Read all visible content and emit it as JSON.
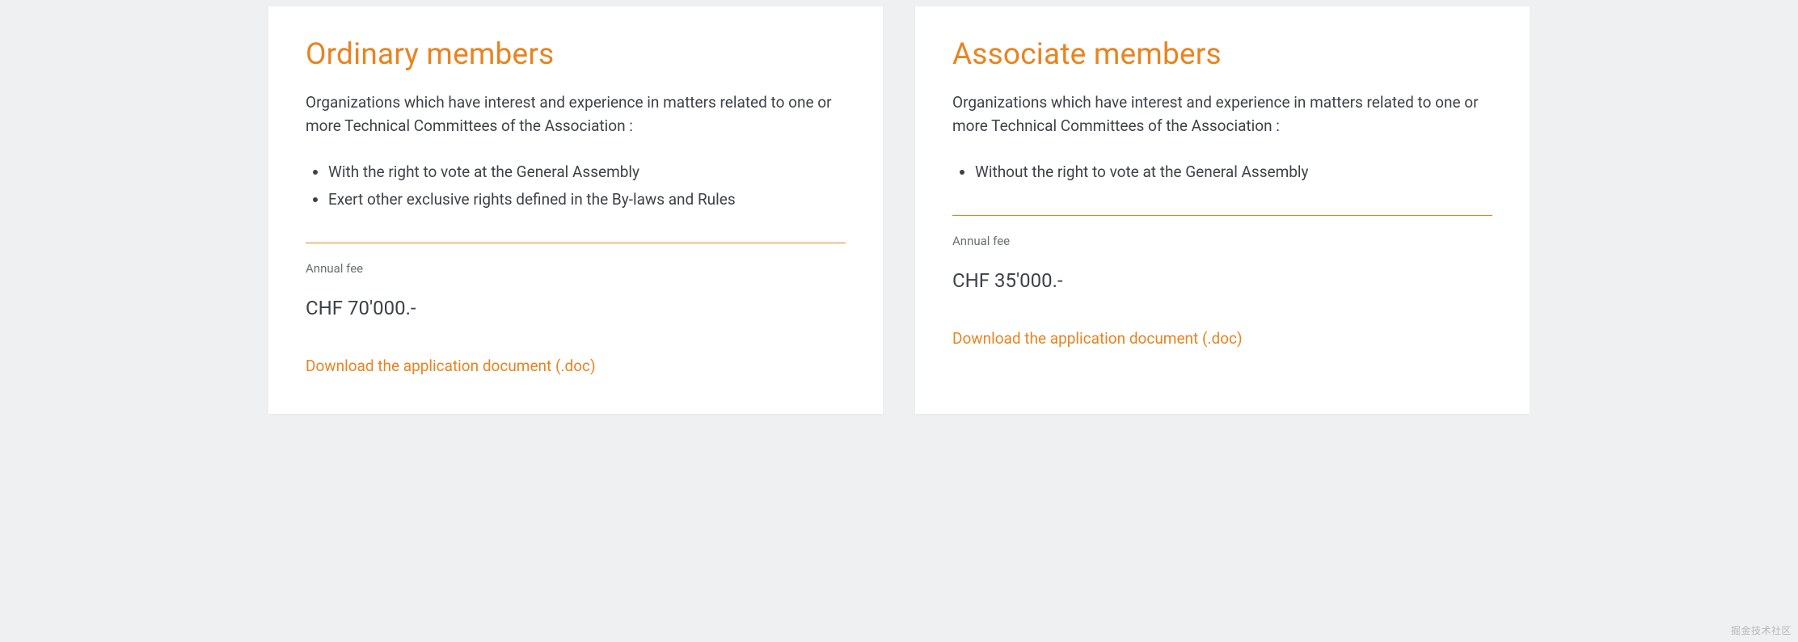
{
  "cards": [
    {
      "title": "Ordinary members",
      "description": "Organizations which have interest and experience in matters related to one or more Technical Committees of the Association :",
      "bullets": [
        "With the right to vote at the General Assembly",
        "Exert other exclusive rights defined in the By-laws and Rules"
      ],
      "fee_label": "Annual fee",
      "fee_amount": "CHF 70'000.-",
      "download_label": "Download the application document (.doc)"
    },
    {
      "title": "Associate members",
      "description": "Organizations which have interest and experience in matters related to one or more Technical Committees of the Association :",
      "bullets": [
        "Without the right to vote at the General Assembly"
      ],
      "fee_label": "Annual fee",
      "fee_amount": "CHF 35'000.-",
      "download_label": "Download the application document (.doc)"
    }
  ],
  "watermark": "掘金技术社区",
  "colors": {
    "accent": "#e88420",
    "background": "#eef0f2",
    "card_bg": "#ffffff",
    "text": "#3d4248"
  }
}
